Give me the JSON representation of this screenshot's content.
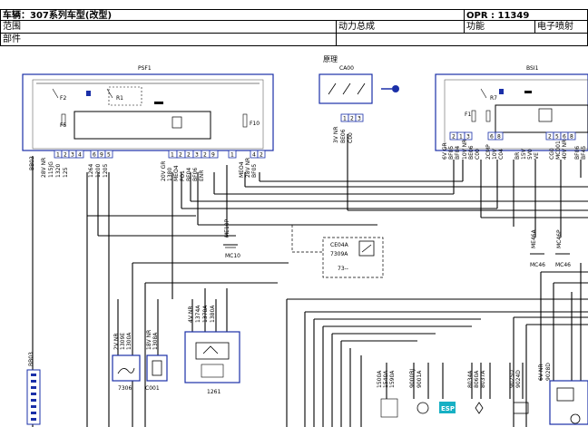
{
  "header": {
    "vehicle": "车辆：307系列车型(改型)",
    "opr": "OPR : 11349",
    "scope_label": "范围",
    "scope_value": "动力总成",
    "function_label": "功能",
    "function_value": "电子喷射",
    "part_label": "部件"
  },
  "diagram": {
    "principle_label": "原理",
    "components": {
      "psf1": "PSF1",
      "ca00": "CA00",
      "bsi1": "BSI1",
      "ce04a": "CE04A",
      "ce04a_sub": "7309A",
      "ce04a_ref": "73--",
      "c7306": "7306",
      "c0001": "C001",
      "c1261": "1261",
      "me10p": "ME10P",
      "mc10": "MC10",
      "me46a": "ME46A",
      "mc46": "MC46",
      "mc46p": "MC46P",
      "mc46b": "MC46",
      "esp": "ESP",
      "bb03": "BB03",
      "bb03b": "BB03"
    },
    "fuse_labels": [
      "F2",
      "F5",
      "F10",
      "R1",
      "F1",
      "R7"
    ],
    "psf1_pins": [
      "1",
      "2",
      "3",
      "4",
      "6",
      "9",
      "5",
      "1",
      "2",
      "2",
      "3",
      "2",
      "9",
      "1",
      "4",
      "2"
    ],
    "ca00_pins": [
      "1",
      "2",
      "3"
    ],
    "bsi1_pins": [
      "2",
      "1",
      "3",
      "6",
      "8",
      "2",
      "5",
      "6",
      "8"
    ],
    "wire_labels_psf1": [
      "28V NR",
      "115JG",
      "1320",
      "125",
      "1264",
      "1200",
      "1205",
      "20V GR",
      "1380",
      "MEO4",
      "FO1",
      "BF04",
      "BF06",
      "ENR",
      "MEO4",
      "28V NR",
      "BF05"
    ],
    "wire_labels_ca00": [
      "3V NR",
      "BE06",
      "C00"
    ],
    "wire_labels_bsi1": [
      "6V GR",
      "BF05",
      "BF04",
      "10V NR",
      "BE06",
      "C00",
      "2CMP",
      "10V",
      "C04",
      "BR",
      "15V",
      "5V0",
      "VE",
      "CG0",
      "MC001",
      "40V NR",
      "BF06",
      "BF45"
    ],
    "wire_labels_lower": [
      "2V NR",
      "1309E",
      "1300A",
      "18V NR",
      "1308A",
      "4V NR",
      "1374A",
      "1378A",
      "1380A",
      "1500A",
      "1540A",
      "1590A",
      "9000BJ",
      "9001A",
      "8034A",
      "8060A",
      "8037A",
      "9025D",
      "9024D",
      "6V NR",
      "9028D",
      "1550"
    ]
  }
}
